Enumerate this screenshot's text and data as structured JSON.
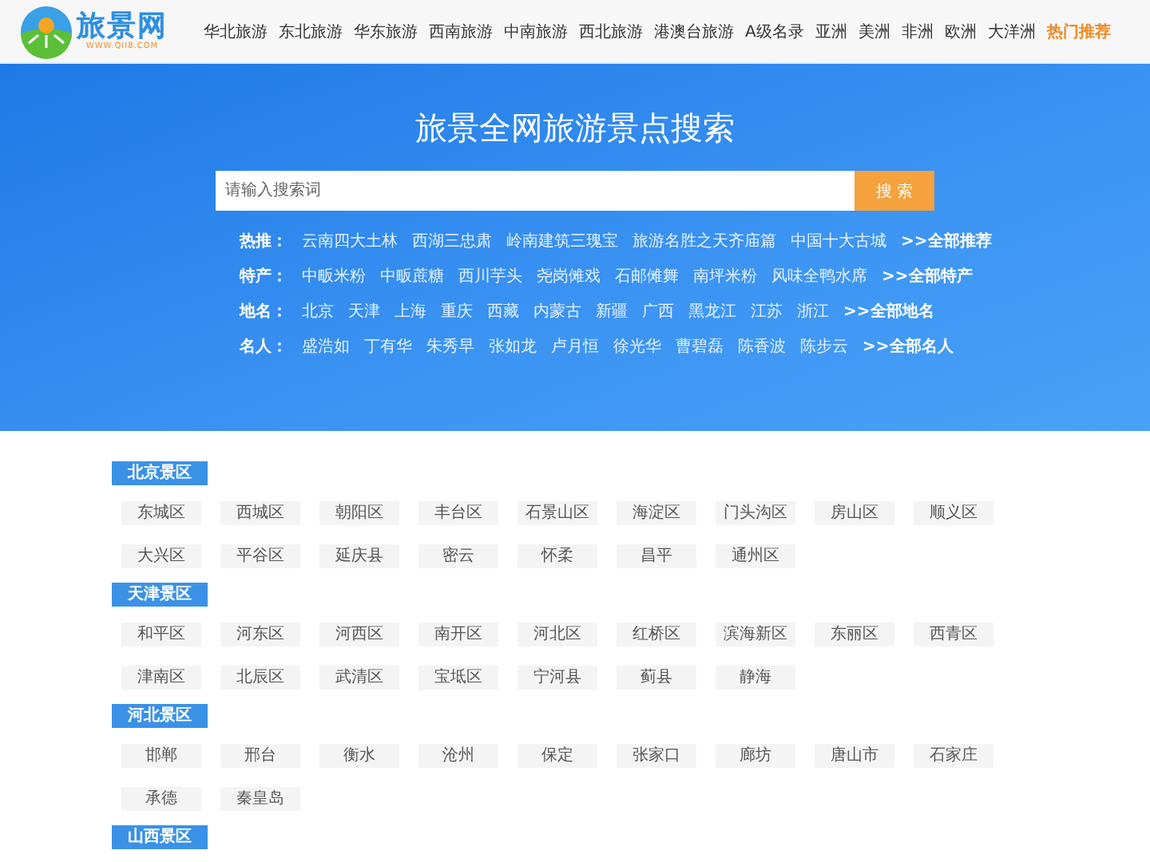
{
  "logo": {
    "name": "旅景网",
    "url": "WWW.QII8.COM"
  },
  "nav": [
    {
      "label": "华北旅游",
      "kind": "normal"
    },
    {
      "label": "东北旅游",
      "kind": "normal"
    },
    {
      "label": "华东旅游",
      "kind": "normal"
    },
    {
      "label": "西南旅游",
      "kind": "normal"
    },
    {
      "label": "中南旅游",
      "kind": "normal"
    },
    {
      "label": "西北旅游",
      "kind": "normal"
    },
    {
      "label": "港澳台旅游",
      "kind": "normal"
    },
    {
      "label": "A级名录",
      "kind": "normal"
    },
    {
      "label": "亚洲",
      "kind": "normal"
    },
    {
      "label": "美洲",
      "kind": "normal"
    },
    {
      "label": "非洲",
      "kind": "normal"
    },
    {
      "label": "欧洲",
      "kind": "normal"
    },
    {
      "label": "大洋洲",
      "kind": "normal"
    },
    {
      "label": "热门推荐",
      "kind": "highlight"
    }
  ],
  "hero": {
    "title": "旅景全网旅游景点搜索",
    "search": {
      "placeholder": "请输入搜索词",
      "button": "搜 索"
    },
    "rows": [
      {
        "label": "热推：",
        "links": [
          "云南四大土林",
          "西湖三忠肃",
          "岭南建筑三瑰宝",
          "旅游名胜之天齐庙篇",
          "中国十大古城"
        ],
        "more": ">>全部推荐"
      },
      {
        "label": "特产：",
        "links": [
          "中畈米粉",
          "中畈蔗糖",
          "西川芋头",
          "尧岗傩戏",
          "石邮傩舞",
          "南坪米粉",
          "风味全鸭水席"
        ],
        "more": ">>全部特产"
      },
      {
        "label": "地名：",
        "links": [
          "北京",
          "天津",
          "上海",
          "重庆",
          "西藏",
          "内蒙古",
          "新疆",
          "广西",
          "黑龙江",
          "江苏",
          "浙江"
        ],
        "more": ">>全部地名"
      },
      {
        "label": "名人：",
        "links": [
          "盛浩如",
          "丁有华",
          "朱秀早",
          "张如龙",
          "卢月恒",
          "徐光华",
          "曹碧磊",
          "陈香波",
          "陈步云"
        ],
        "more": ">>全部名人"
      }
    ]
  },
  "sections": [
    {
      "title": "北京景区",
      "tags": [
        "东城区",
        "西城区",
        "朝阳区",
        "丰台区",
        "石景山区",
        "海淀区",
        "门头沟区",
        "房山区",
        "顺义区",
        "大兴区",
        "平谷区",
        "延庆县",
        "密云",
        "怀柔",
        "昌平",
        "通州区"
      ]
    },
    {
      "title": "天津景区",
      "tags": [
        "和平区",
        "河东区",
        "河西区",
        "南开区",
        "河北区",
        "红桥区",
        "滨海新区",
        "东丽区",
        "西青区",
        "津南区",
        "北辰区",
        "武清区",
        "宝坻区",
        "宁河县",
        "蓟县",
        "静海"
      ]
    },
    {
      "title": "河北景区",
      "tags": [
        "邯郸",
        "邢台",
        "衡水",
        "沧州",
        "保定",
        "张家口",
        "廊坊",
        "唐山市",
        "石家庄",
        "承德",
        "秦皇岛"
      ]
    },
    {
      "title": "山西景区"
    }
  ]
}
